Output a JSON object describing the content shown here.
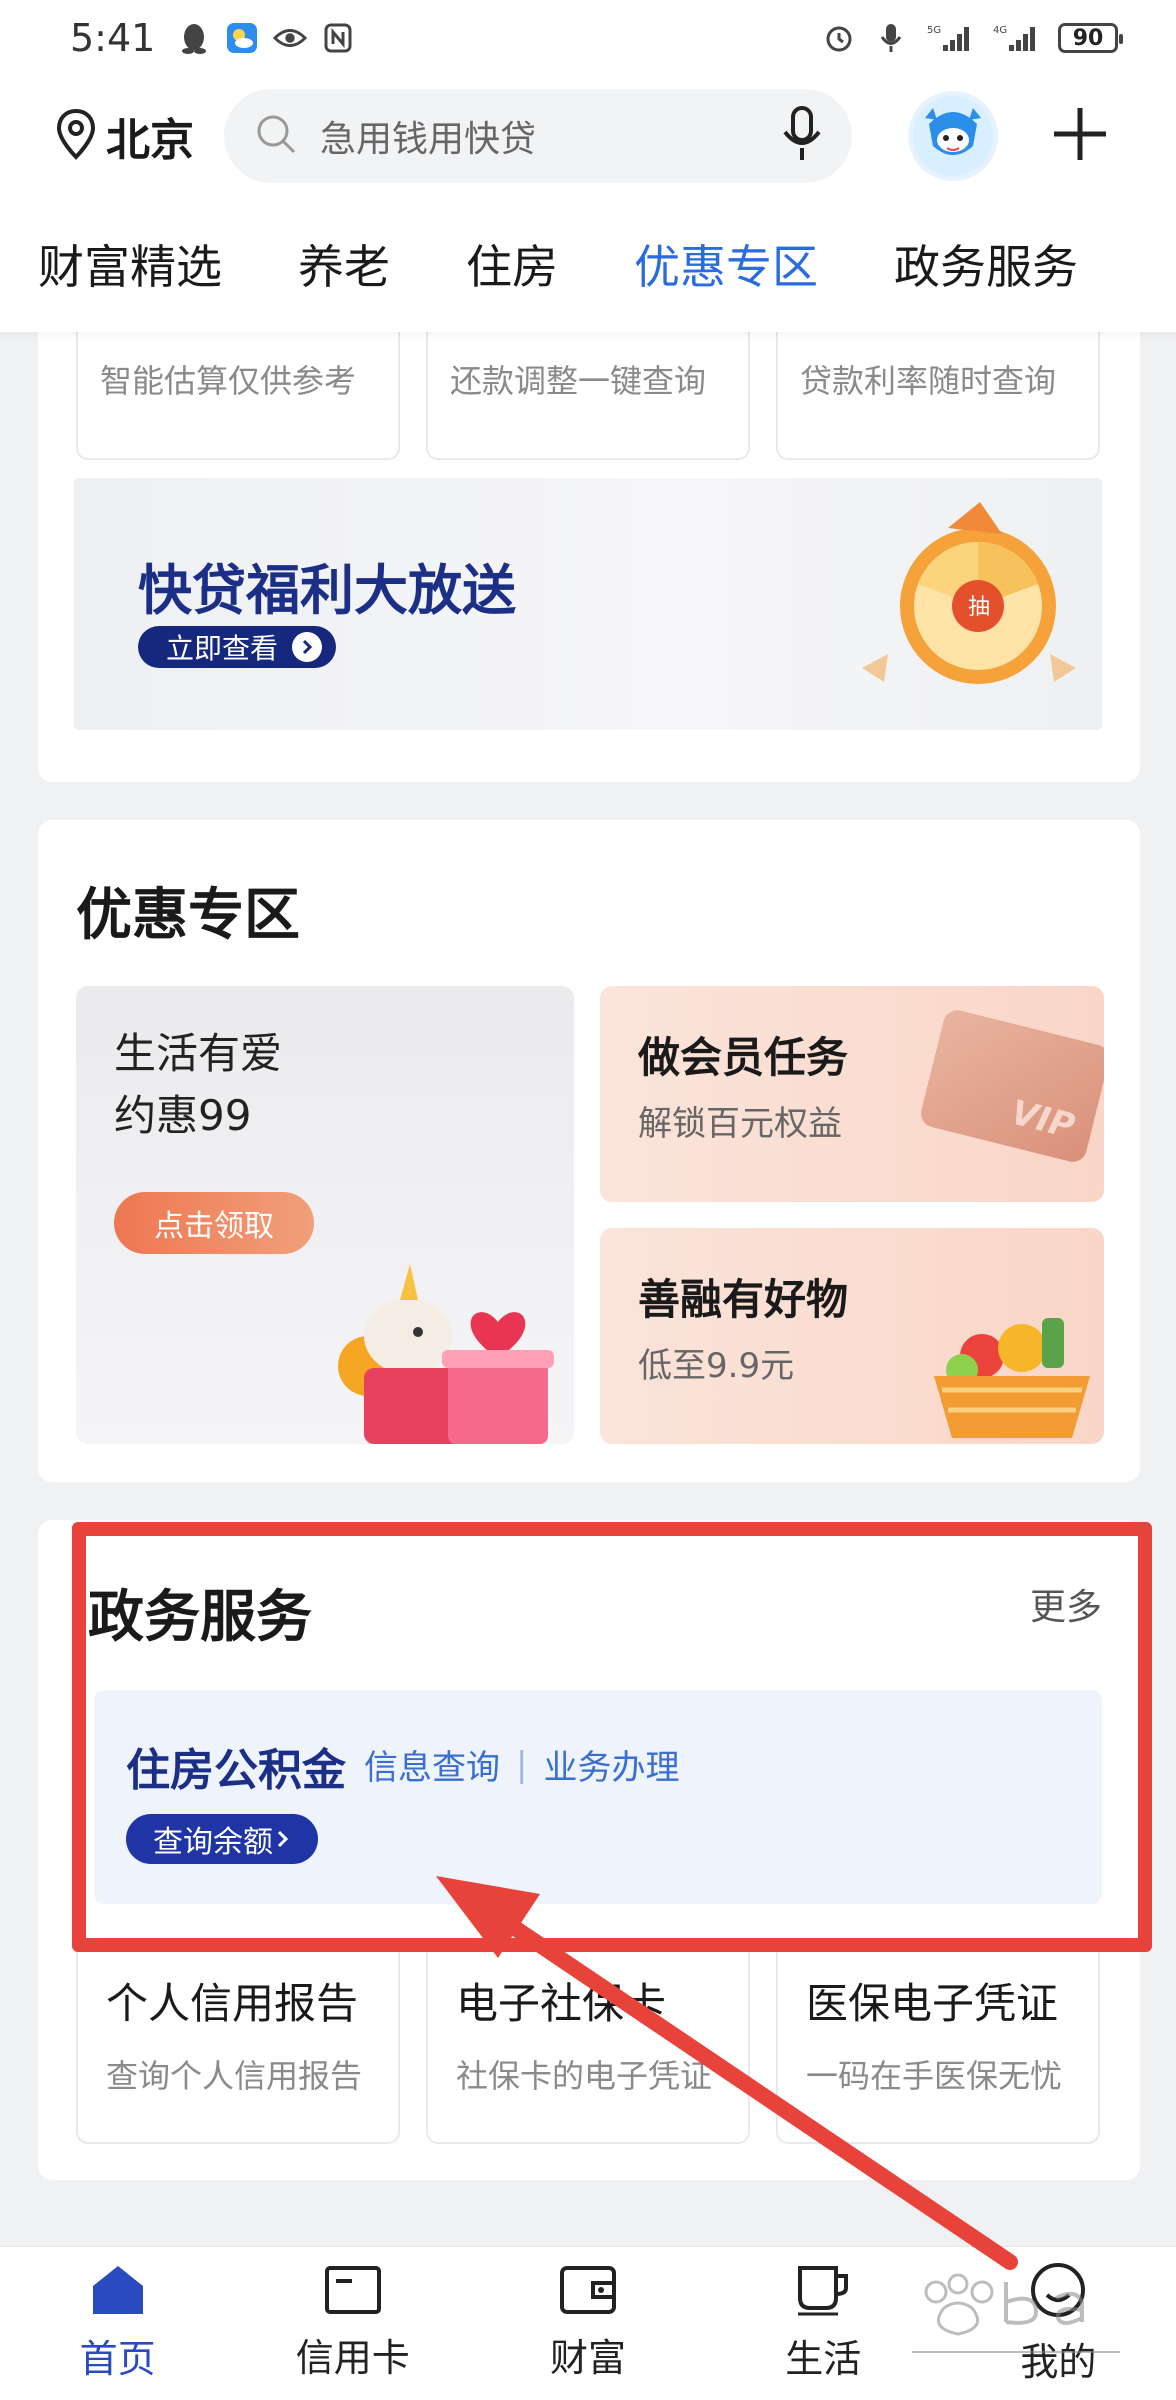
{
  "status_bar": {
    "time": "5:41",
    "battery": "90",
    "left_icons": [
      "qq-icon",
      "weather-icon",
      "eye-icon",
      "nfc-icon"
    ],
    "right_icons": [
      "alarm-icon",
      "mic-icon",
      "signal-5g-icon",
      "signal-4g-icon",
      "battery-icon"
    ]
  },
  "header": {
    "location": "北京",
    "search_placeholder": "急用钱用快贷"
  },
  "tabs": [
    {
      "label": "财富精选",
      "active": false
    },
    {
      "label": "养老",
      "active": false
    },
    {
      "label": "住房",
      "active": false
    },
    {
      "label": "优惠专区",
      "active": true
    },
    {
      "label": "政务服务",
      "active": false
    }
  ],
  "loan_card": {
    "tiles": [
      "智能估算仅供参考",
      "还款调整一键查询",
      "贷款利率随时查询"
    ],
    "banner_title": "快贷福利大放送",
    "banner_button": "立即查看"
  },
  "promo_section": {
    "title": "优惠专区",
    "left": {
      "line1": "生活有爱",
      "line2": "约惠99",
      "button": "点击领取"
    },
    "right_top": {
      "title": "做会员任务",
      "subtitle": "解锁百元权益",
      "card_text": "VIP"
    },
    "right_bottom": {
      "title": "善融有好物",
      "subtitle": "低至9.9元"
    }
  },
  "gov_section": {
    "title": "政务服务",
    "more": "更多",
    "fund": {
      "title": "住房公积金",
      "link1": "信息查询",
      "separator": "|",
      "link2": "业务办理",
      "button": "查询余额"
    },
    "tiles": [
      {
        "title": "个人信用报告",
        "subtitle": "查询个人信用报告"
      },
      {
        "title": "电子社保卡",
        "subtitle": "社保卡的电子凭证"
      },
      {
        "title": "医保电子凭证",
        "subtitle": "一码在手医保无忧"
      }
    ]
  },
  "bottom_nav": [
    {
      "label": "首页",
      "icon": "home-icon",
      "active": true
    },
    {
      "label": "信用卡",
      "icon": "credit-card-icon",
      "active": false
    },
    {
      "label": "财富",
      "icon": "wallet-icon",
      "active": false
    },
    {
      "label": "生活",
      "icon": "cup-icon",
      "active": false
    },
    {
      "label": "我的",
      "icon": "profile-icon",
      "active": false
    }
  ],
  "colors": {
    "accent": "#2a6bde",
    "navy": "#1c2f86",
    "highlight_red": "#e8433b"
  }
}
